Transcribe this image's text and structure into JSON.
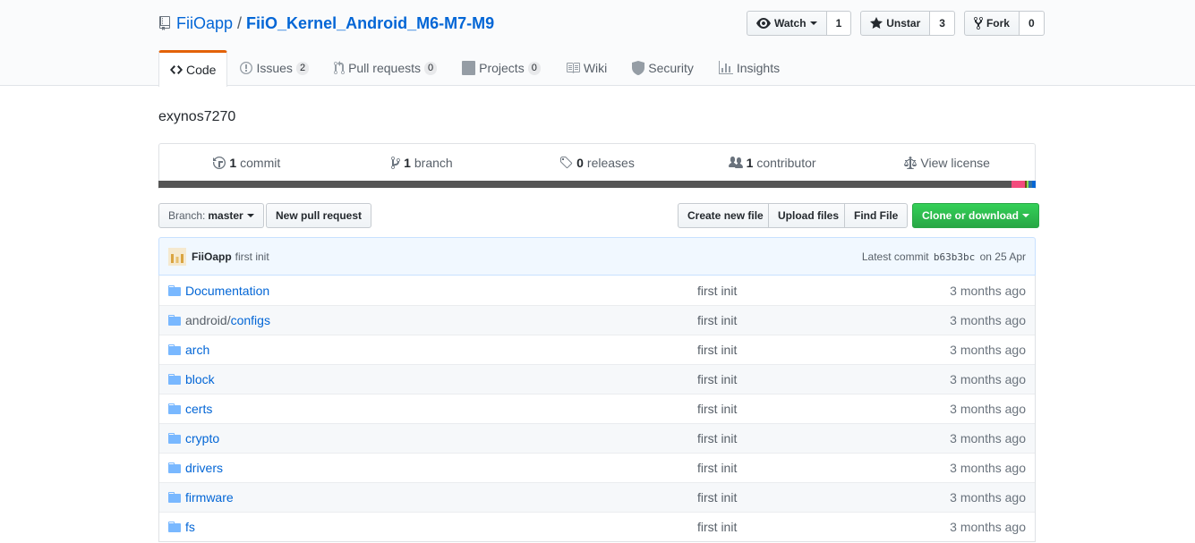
{
  "repo": {
    "owner": "FiiOapp",
    "separator": "/",
    "name": "FiiO_Kernel_Android_M6-M7-M9",
    "description": "exynos7270"
  },
  "actions": {
    "watch_label": "Watch",
    "watch_count": "1",
    "star_label": "Unstar",
    "star_count": "3",
    "fork_label": "Fork",
    "fork_count": "0"
  },
  "tabs": [
    {
      "label": "Code",
      "icon": "code-icon"
    },
    {
      "label": "Issues",
      "counter": "2",
      "icon": "issue-icon"
    },
    {
      "label": "Pull requests",
      "counter": "0",
      "icon": "pull-request-icon"
    },
    {
      "label": "Projects",
      "counter": "0",
      "icon": "project-icon"
    },
    {
      "label": "Wiki",
      "icon": "book-icon"
    },
    {
      "label": "Security",
      "icon": "shield-icon"
    },
    {
      "label": "Insights",
      "icon": "graph-icon"
    }
  ],
  "summary": {
    "commits_count": "1",
    "commits_label": "commit",
    "branches_count": "1",
    "branches_label": "branch",
    "releases_count": "0",
    "releases_label": "releases",
    "contributors_count": "1",
    "contributors_label": "contributor",
    "license_label": "View license"
  },
  "languages": [
    {
      "color": "#555555",
      "percent": 97.2
    },
    {
      "color": "#f34b7d",
      "percent": 1.6
    },
    {
      "color": "#6e4c13",
      "percent": 0.2
    },
    {
      "color": "#89e051",
      "percent": 0.2
    },
    {
      "color": "#3572a5",
      "percent": 0.4
    },
    {
      "color": "#0366d6",
      "percent": 0.4
    }
  ],
  "filebar": {
    "branch_prefix": "Branch:",
    "branch_name": "master",
    "new_pr": "New pull request",
    "create_file": "Create new file",
    "upload_files": "Upload files",
    "find_file": "Find File",
    "clone": "Clone or download"
  },
  "commit": {
    "author": "FiiOapp",
    "message": "first init",
    "latest_label": "Latest commit",
    "sha": "b63b3bc",
    "date": "on 25 Apr"
  },
  "files": [
    {
      "name": "Documentation",
      "message": "first init",
      "age": "3 months ago"
    },
    {
      "parent": "android/",
      "name": "configs",
      "message": "first init",
      "age": "3 months ago"
    },
    {
      "name": "arch",
      "message": "first init",
      "age": "3 months ago"
    },
    {
      "name": "block",
      "message": "first init",
      "age": "3 months ago"
    },
    {
      "name": "certs",
      "message": "first init",
      "age": "3 months ago"
    },
    {
      "name": "crypto",
      "message": "first init",
      "age": "3 months ago"
    },
    {
      "name": "drivers",
      "message": "first init",
      "age": "3 months ago"
    },
    {
      "name": "firmware",
      "message": "first init",
      "age": "3 months ago"
    },
    {
      "name": "fs",
      "message": "first init",
      "age": "3 months ago"
    }
  ]
}
